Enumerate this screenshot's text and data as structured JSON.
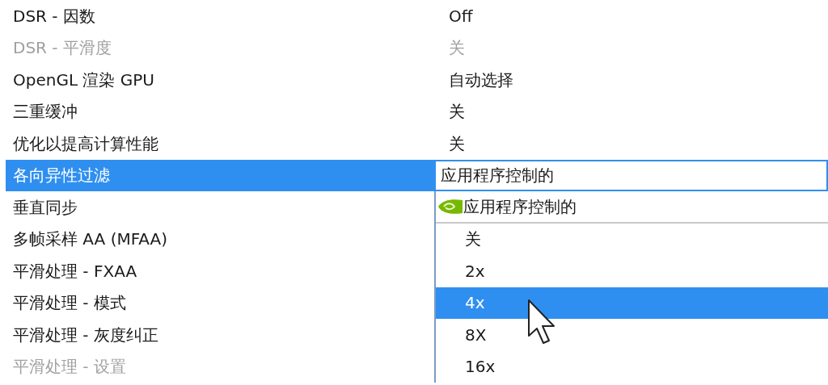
{
  "settings": [
    {
      "label": "DSR - 因数",
      "value": "Off",
      "disabled": false,
      "selected": false
    },
    {
      "label": "DSR - 平滑度",
      "value": "关",
      "disabled": true,
      "selected": false
    },
    {
      "label": "OpenGL 渲染 GPU",
      "value": "自动选择",
      "disabled": false,
      "selected": false
    },
    {
      "label": "三重缓冲",
      "value": "关",
      "disabled": false,
      "selected": false
    },
    {
      "label": "优化以提高计算性能",
      "value": "关",
      "disabled": false,
      "selected": false
    },
    {
      "label": "各向异性过滤",
      "value": "应用程序控制的",
      "disabled": false,
      "selected": true
    },
    {
      "label": "垂直同步",
      "disabled": false,
      "selected": false
    },
    {
      "label": "多帧采样 AA (MFAA)",
      "disabled": false,
      "selected": false
    },
    {
      "label": "平滑处理 - FXAA",
      "disabled": false,
      "selected": false
    },
    {
      "label": "平滑处理 - 模式",
      "disabled": false,
      "selected": false
    },
    {
      "label": "平滑处理 - 灰度纠正",
      "disabled": false,
      "selected": false
    },
    {
      "label": "平滑处理 - 设置",
      "disabled": true,
      "selected": false
    }
  ],
  "dropdown": {
    "options": [
      {
        "label": "应用程序控制的",
        "kind": "default",
        "selected": false
      },
      {
        "label": "关",
        "kind": "plain",
        "selected": false
      },
      {
        "label": "2x",
        "kind": "plain",
        "selected": false
      },
      {
        "label": "4x",
        "kind": "plain",
        "selected": true
      },
      {
        "label": "8X",
        "kind": "plain",
        "selected": false
      },
      {
        "label": "16x",
        "kind": "plain",
        "selected": false
      }
    ]
  }
}
